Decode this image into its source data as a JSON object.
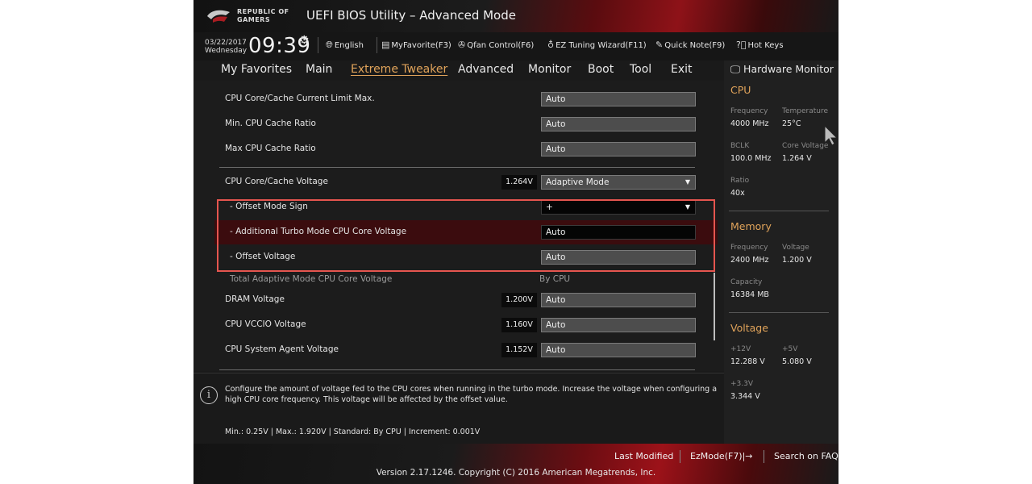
{
  "header": {
    "brand_line1": "REPUBLIC OF",
    "brand_line2": "GAMERS",
    "title": "UEFI BIOS Utility – Advanced Mode"
  },
  "toolbar": {
    "date": "03/22/2017",
    "day": "Wednesday",
    "time": "09:39",
    "language": "English",
    "myfavorite": "MyFavorite(F3)",
    "qfan": "Qfan Control(F6)",
    "ez_tuning": "EZ Tuning Wizard(F11)",
    "quick_note": "Quick Note(F9)",
    "hot_keys": "Hot Keys"
  },
  "tabs": [
    "My Favorites",
    "Main",
    "Extreme Tweaker",
    "Advanced",
    "Monitor",
    "Boot",
    "Tool",
    "Exit"
  ],
  "active_tab": "Extreme Tweaker",
  "settings": {
    "cache_current_limit": {
      "label": "CPU Core/Cache Current Limit Max.",
      "value": "Auto"
    },
    "min_cache_ratio": {
      "label": "Min. CPU Cache Ratio",
      "value": "Auto"
    },
    "max_cache_ratio": {
      "label": "Max CPU Cache Ratio",
      "value": "Auto"
    },
    "core_cache_voltage": {
      "label": "CPU Core/Cache Voltage",
      "reading": "1.264V",
      "value": "Adaptive Mode"
    },
    "offset_mode_sign": {
      "label": "- Offset Mode Sign",
      "value": "+"
    },
    "turbo_core_voltage": {
      "label": "- Additional Turbo Mode CPU Core Voltage",
      "value": "Auto"
    },
    "offset_voltage": {
      "label": "- Offset Voltage",
      "value": "Auto"
    },
    "total_adaptive": {
      "label": "Total Adaptive Mode CPU Core Voltage",
      "value": "By CPU"
    },
    "dram_voltage": {
      "label": "DRAM Voltage",
      "reading": "1.200V",
      "value": "Auto"
    },
    "vccio_voltage": {
      "label": "CPU VCCIO Voltage",
      "reading": "1.160V",
      "value": "Auto"
    },
    "system_agent_voltage": {
      "label": "CPU System Agent Voltage",
      "reading": "1.152V",
      "value": "Auto"
    }
  },
  "help": {
    "text": "Configure the amount of voltage fed to the CPU cores when running in the turbo mode. Increase the voltage when configuring a high CPU core frequency. This voltage will be affected by the offset value.",
    "limits": "Min.: 0.25V   |   Max.: 1.920V   |   Standard: By CPU   |   Increment: 0.001V"
  },
  "hardware_monitor": {
    "title": "Hardware Monitor",
    "cpu": {
      "section": "CPU",
      "frequency_label": "Frequency",
      "frequency": "4000 MHz",
      "temperature_label": "Temperature",
      "temperature": "25°C",
      "bclk_label": "BCLK",
      "bclk": "100.0 MHz",
      "core_voltage_label": "Core Voltage",
      "core_voltage": "1.264 V",
      "ratio_label": "Ratio",
      "ratio": "40x"
    },
    "memory": {
      "section": "Memory",
      "frequency_label": "Frequency",
      "frequency": "2400 MHz",
      "voltage_label": "Voltage",
      "voltage": "1.200 V",
      "capacity_label": "Capacity",
      "capacity": "16384 MB"
    },
    "voltage": {
      "section": "Voltage",
      "v12_label": "+12V",
      "v12": "12.288 V",
      "v5_label": "+5V",
      "v5": "5.080 V",
      "v33_label": "+3.3V",
      "v33": "3.344 V"
    }
  },
  "footer": {
    "last_modified": "Last Modified",
    "ezmode": "EzMode(F7)|→",
    "search_faq": "Search on FAQ",
    "copyright": "Version 2.17.1246. Copyright (C) 2016 American Megatrends, Inc."
  }
}
